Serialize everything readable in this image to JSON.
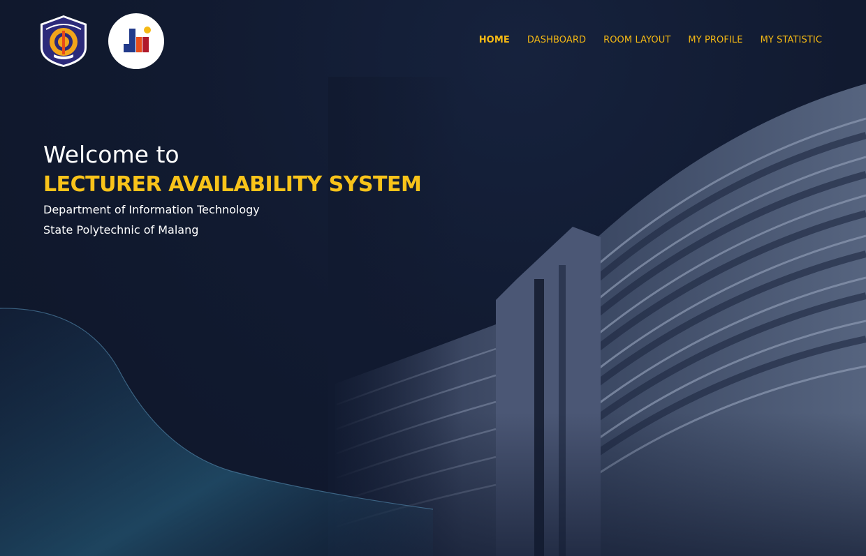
{
  "header": {
    "logos": [
      {
        "icon": "polinema-emblem-icon",
        "name": "Politeknik Negeri Malang emblem"
      },
      {
        "icon": "jti-logo-icon",
        "name": "JTI logo"
      }
    ],
    "nav": [
      {
        "label": "HOME",
        "active": true
      },
      {
        "label": "DASHBOARD",
        "active": false
      },
      {
        "label": "ROOM LAYOUT",
        "active": false
      },
      {
        "label": "MY PROFILE",
        "active": false
      },
      {
        "label": "MY STATISTIC",
        "active": false
      }
    ]
  },
  "hero": {
    "welcome": "Welcome to",
    "title": "LECTURER AVAILABILITY SYSTEM",
    "line1": "Department of Information Technology",
    "line2": "State Polytechnic of Malang"
  },
  "colors": {
    "background": "#111a30",
    "accent": "#f9c31a",
    "nav_text": "#f5b914",
    "text": "#ffffff"
  }
}
